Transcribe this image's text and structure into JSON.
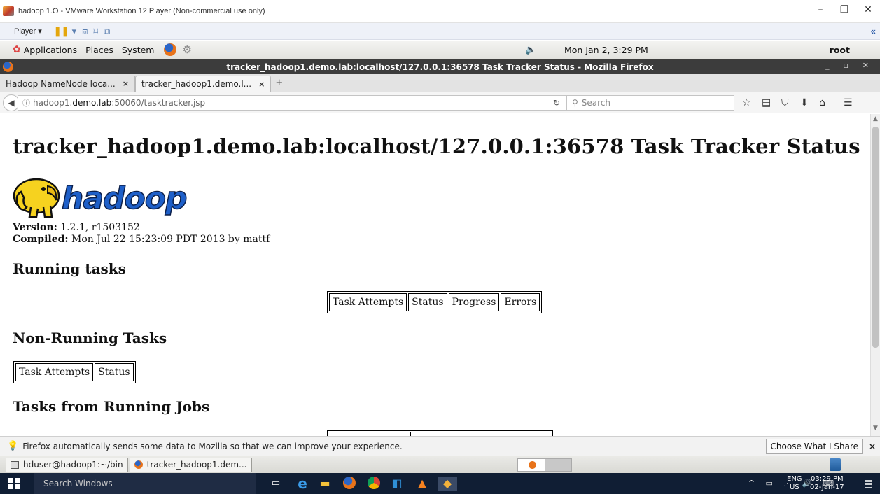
{
  "vmware": {
    "title": "hadoop 1.O - VMware Workstation 12 Player (Non-commercial use only)",
    "player_menu": "Player ▾",
    "controls": {
      "minimize": "–",
      "restore": "❐",
      "close": "✕"
    },
    "collapse": "«"
  },
  "gnome_panel": {
    "menus": [
      "Applications",
      "Places",
      "System"
    ],
    "clock": "Mon Jan  2,  3:29 PM",
    "user": "root"
  },
  "firefox": {
    "window_title": "tracker_hadoop1.demo.lab:localhost/127.0.0.1:36578 Task Tracker Status - Mozilla Firefox",
    "window_controls": "_ ▫ ✕",
    "tabs": [
      {
        "label": "Hadoop NameNode loca...",
        "close": "×"
      },
      {
        "label": "tracker_hadoop1.demo.l...",
        "close": "×"
      }
    ],
    "new_tab": "+",
    "url_prefix": "hadoop1.",
    "url_host": "demo.lab",
    "url_path": ":50060/tasktracker.jsp",
    "search_placeholder": "Search"
  },
  "page": {
    "heading": "tracker_hadoop1.demo.lab:localhost/127.0.0.1:36578 Task Tracker Status",
    "logo_text": "hadoop",
    "version_label": "Version:",
    "version_value": " 1.2.1, r1503152",
    "compiled_label": "Compiled:",
    "compiled_value": " Mon Jul 22 15:23:09 PDT 2013 by mattf",
    "running_tasks": {
      "title": "Running tasks",
      "columns": [
        "Task Attempts",
        "Status",
        "Progress",
        "Errors"
      ]
    },
    "non_running": {
      "title": "Non-Running Tasks",
      "columns": [
        "Task Attempts",
        "Status"
      ]
    },
    "from_running_jobs": {
      "title": "Tasks from Running Jobs"
    }
  },
  "notification": {
    "message": "Firefox automatically sends some data to Mozilla so that we can improve your experience.",
    "button": "Choose What I Share",
    "close": "×"
  },
  "gnome_bottom": {
    "tasks": [
      "hduser@hadoop1:~/bin",
      "tracker_hadoop1.dem..."
    ]
  },
  "windows_taskbar": {
    "search_placeholder": "Search Windows",
    "lang_top": "ENG",
    "lang_bottom": "US",
    "time": "03:29 PM",
    "date": "02-Jan-17"
  }
}
